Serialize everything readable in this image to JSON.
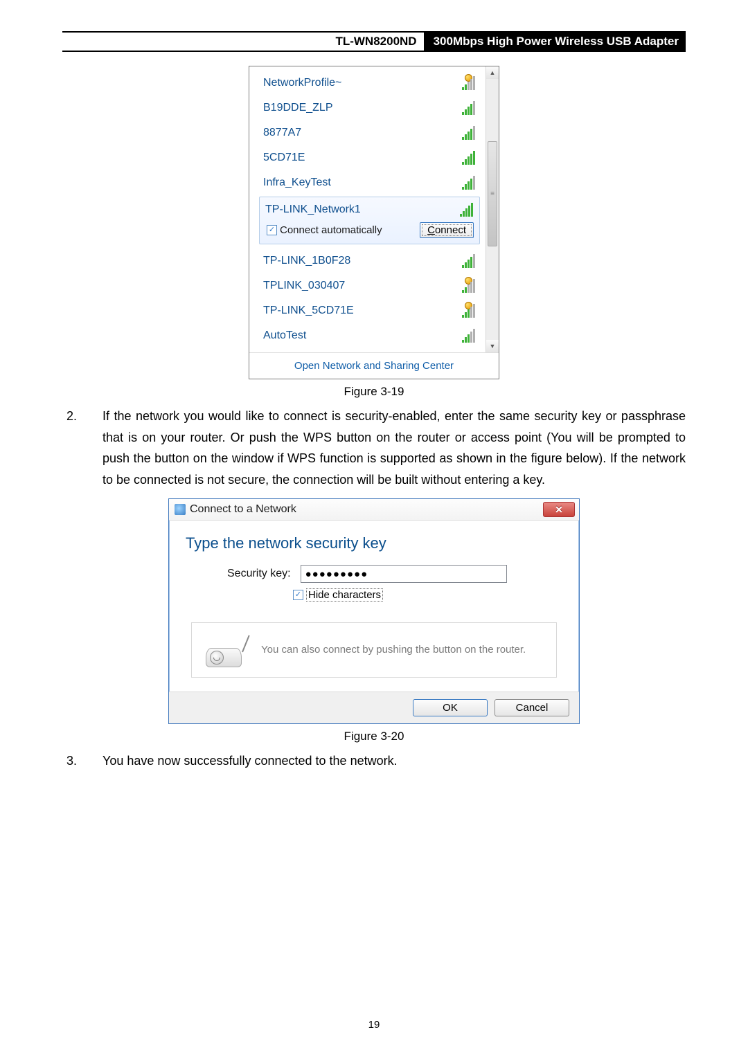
{
  "header": {
    "model": "TL-WN8200ND",
    "product": "300Mbps High Power Wireless USB Adapter"
  },
  "flyout": {
    "networks": [
      {
        "name": "NetworkProfile~",
        "signal": 2,
        "warn": true
      },
      {
        "name": "B19DDE_ZLP",
        "signal": 4,
        "warn": false
      },
      {
        "name": "8877A7",
        "signal": 4,
        "warn": false
      },
      {
        "name": "5CD71E",
        "signal": 5,
        "warn": false
      },
      {
        "name": "Infra_KeyTest",
        "signal": 4,
        "warn": false
      }
    ],
    "selected": {
      "name": "TP-LINK_Network1",
      "signal": 5,
      "auto_label": "Connect automatically",
      "connect_label": "Connect"
    },
    "networks_after": [
      {
        "name": "TP-LINK_1B0F28",
        "signal": 4,
        "warn": false
      },
      {
        "name": "TPLINK_030407",
        "signal": 2,
        "warn": true
      },
      {
        "name": "TP-LINK_5CD71E",
        "signal": 3,
        "warn": true
      },
      {
        "name": "AutoTest",
        "signal": 3,
        "warn": false
      }
    ],
    "footer_link": "Open Network and Sharing Center"
  },
  "caption1": "Figure 3-19",
  "step2": {
    "num": "2.",
    "text": "If the network you would like to connect is security-enabled, enter the same security key or passphrase that is on your router. Or push the WPS button on the router or access point (You will be prompted to push the button on the window if WPS function is supported as shown in the figure below). If the network to be connected is not secure, the connection will be built without entering a key."
  },
  "dialog": {
    "title": "Connect to a Network",
    "heading": "Type the network security key",
    "key_label": "Security key:",
    "key_value": "●●●●●●●●●",
    "hide_label": "Hide characters",
    "wps_text": "You can also connect by pushing the button on the router.",
    "ok": "OK",
    "cancel": "Cancel"
  },
  "caption2": "Figure 3-20",
  "step3": {
    "num": "3.",
    "text": "You have now successfully connected to the network."
  },
  "page_number": "19"
}
